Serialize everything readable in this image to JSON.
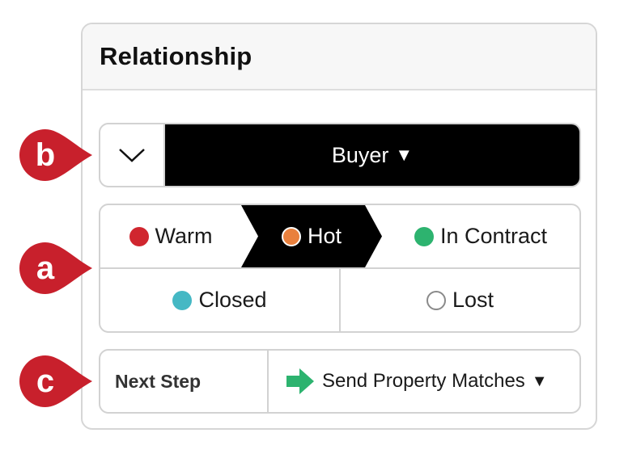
{
  "panel": {
    "title": "Relationship"
  },
  "relationship_type": {
    "selected": "Buyer",
    "caret": "▼"
  },
  "statuses": {
    "row1": [
      {
        "label": "Warm",
        "color": "#d0262f",
        "active": false
      },
      {
        "label": "Hot",
        "color": "#e9803d",
        "active": true
      },
      {
        "label": "In Contract",
        "color": "#2db36f",
        "active": false
      }
    ],
    "row2": [
      {
        "label": "Closed",
        "color": "#45b8c4"
      },
      {
        "label": "Lost",
        "color": "#ffffff"
      }
    ]
  },
  "next_step": {
    "label": "Next Step",
    "selected": "Send Property Matches",
    "caret": "▼",
    "icon_color": "#2db36f"
  },
  "callouts": {
    "a": "a",
    "b": "b",
    "c": "c",
    "color": "#c8202c"
  }
}
